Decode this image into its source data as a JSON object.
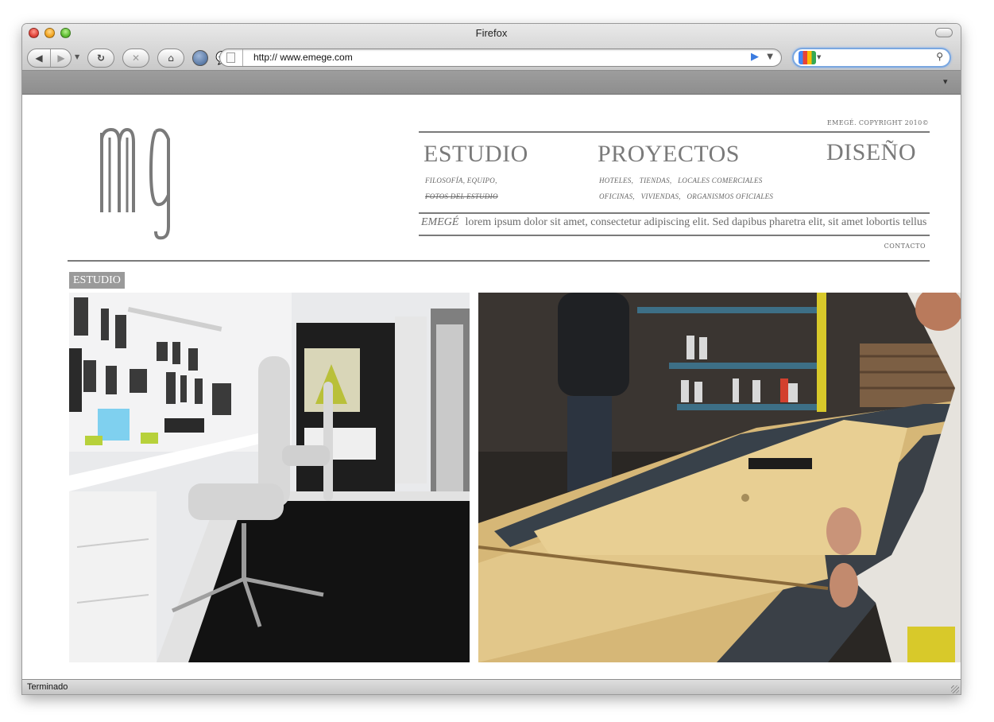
{
  "browser": {
    "window_title": "Firefox",
    "url": "http:// www.emege.com",
    "search_placeholder": "",
    "status": "Terminado"
  },
  "site": {
    "logo_text": "mg",
    "copyright": "EMEGÉ. COPYRIGHT 2010©",
    "nav": [
      {
        "label": "ESTUDIO",
        "sub": [
          "FILOSOFÍA, EQUIPO,",
          "FOTOS DEL ESTUDIO"
        ]
      },
      {
        "label": "PROYECTOS",
        "sub": [
          "HOTELES,   TIENDAS,   LOCALES COMERCIALES",
          "OFICINAS,   VIVIENDAS,   ORGANISMOS OFICIALES"
        ]
      },
      {
        "label": "DISEÑO",
        "sub": []
      }
    ],
    "tagline_brand": "EMEGÉ",
    "tagline_text": "lorem ipsum dolor sit amet, consectetur adipiscing elit. Sed dapibus pharetra elit, sit amet lobortis tellus",
    "contact": "CONTACTO",
    "section_label": "ESTUDIO"
  },
  "icons": {
    "back": "back-arrow-icon",
    "forward": "forward-arrow-icon",
    "reload": "reload-icon",
    "stop": "stop-icon",
    "home": "home-icon",
    "search_engine": "google-icon",
    "search": "magnifier-icon"
  },
  "colors": {
    "text_gray": "#7a7a7a",
    "rule_gray": "#7a7a7a",
    "label_bg": "#9a9a9a"
  }
}
